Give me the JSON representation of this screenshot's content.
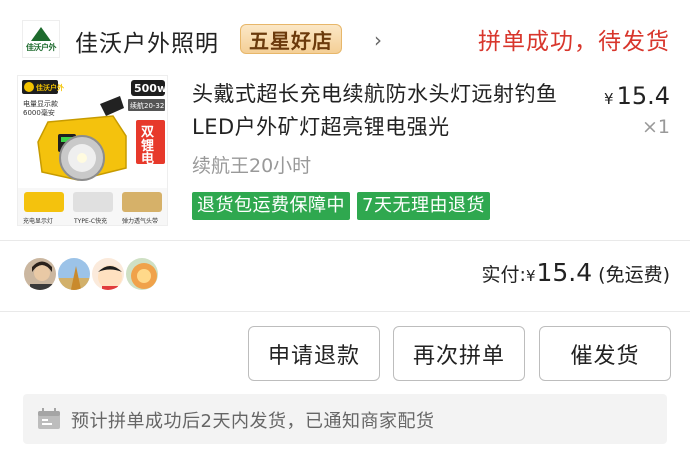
{
  "shop": {
    "logo_text": "佳沃户外",
    "name": "佳沃户外照明",
    "badge": "五星好店",
    "arrow": "›"
  },
  "order": {
    "status": "拼单成功，待发货"
  },
  "product": {
    "title": "头戴式超长充电续航防水头灯远射钓鱼LED户外矿灯超亮锂电强光",
    "variant": "续航王20小时",
    "price": "15.4",
    "currency": "¥",
    "quantity": "×1",
    "tags": [
      "退货包运费保障中",
      "7天无理由退货"
    ],
    "image_labels": {
      "brand": "佳沃户外",
      "wattage": "500w",
      "battery_note": "电量显示款",
      "capacity": "6000毫安",
      "side_label": "双锂电",
      "endurance": "续航20-32",
      "feature1": "充电显示灯",
      "feature2": "TYPE-C快充",
      "feature3": "弹力透气头带"
    }
  },
  "summary": {
    "paid_label": "实付:",
    "currency": "¥",
    "amount": "15.4",
    "shipping_note": "(免运费)"
  },
  "actions": {
    "refund": "申请退款",
    "regroup": "再次拼单",
    "urge": "催发货"
  },
  "notice": {
    "text": "预计拼单成功后2天内发货，已通知商家配货"
  },
  "colors": {
    "status_red": "#d8362c",
    "tag_green": "#2fa84f",
    "badge_gold": "#f4cf96"
  }
}
